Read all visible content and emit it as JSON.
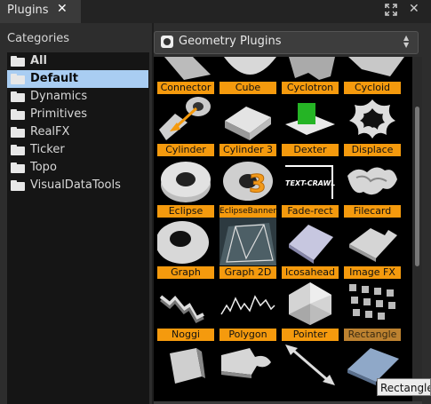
{
  "tab": {
    "title": "Plugins",
    "close_glyph": "✕"
  },
  "window": {
    "expand_icon": "expand-icon",
    "close_glyph": "✕"
  },
  "categories": {
    "title": "Categories",
    "items": [
      {
        "label": "All",
        "bold": true
      },
      {
        "label": "Default",
        "bold": true,
        "selected": true
      },
      {
        "label": "Dynamics"
      },
      {
        "label": "Primitives"
      },
      {
        "label": "RealFX"
      },
      {
        "label": "Ticker"
      },
      {
        "label": "Topo"
      },
      {
        "label": "VisualDataTools"
      }
    ]
  },
  "plugin_dropdown": {
    "label": "Geometry Plugins"
  },
  "plugins": [
    {
      "label": "Connector",
      "icon": "connector-thumbnail"
    },
    {
      "label": "Cube",
      "icon": "cube-thumbnail"
    },
    {
      "label": "Cyclotron",
      "icon": "cyclotron-thumbnail"
    },
    {
      "label": "Cycloid",
      "icon": "cycloid-thumbnail"
    },
    {
      "label": "Cylinder",
      "icon": "cylinder-thumbnail"
    },
    {
      "label": "Cylinder 3",
      "icon": "cylinder3-thumbnail"
    },
    {
      "label": "Dexter",
      "icon": "dexter-thumbnail",
      "thumb_text": "TEXT-CRAWL"
    },
    {
      "label": "Displace",
      "icon": "displace-thumbnail"
    },
    {
      "label": "Eclipse",
      "icon": "eclipse-thumbnail"
    },
    {
      "label": "EclipseBanner",
      "icon": "eclipsebanner-thumbnail",
      "small": true
    },
    {
      "label": "Fade-rect",
      "icon": "fade-rect-thumbnail"
    },
    {
      "label": "Filecard",
      "icon": "filecard-thumbnail"
    },
    {
      "label": "Graph",
      "icon": "graph-thumbnail"
    },
    {
      "label": "Graph 2D",
      "icon": "graph2d-thumbnail"
    },
    {
      "label": "Icosahead",
      "icon": "icosahead-thumbnail"
    },
    {
      "label": "Image FX",
      "icon": "imagefx-thumbnail"
    },
    {
      "label": "Noggi",
      "icon": "noggi-thumbnail"
    },
    {
      "label": "Polygon",
      "icon": "polygon-thumbnail"
    },
    {
      "label": "Pointer",
      "icon": "pointer-thumbnail"
    },
    {
      "label": "Rectangle",
      "icon": "rectangle-thumbnail",
      "dim": true
    }
  ],
  "tooltip": {
    "text": "Rectangle"
  },
  "colors": {
    "label_bg": "#f59a0d",
    "selection": "#a9cdf2",
    "background": "#2b2b2b"
  }
}
